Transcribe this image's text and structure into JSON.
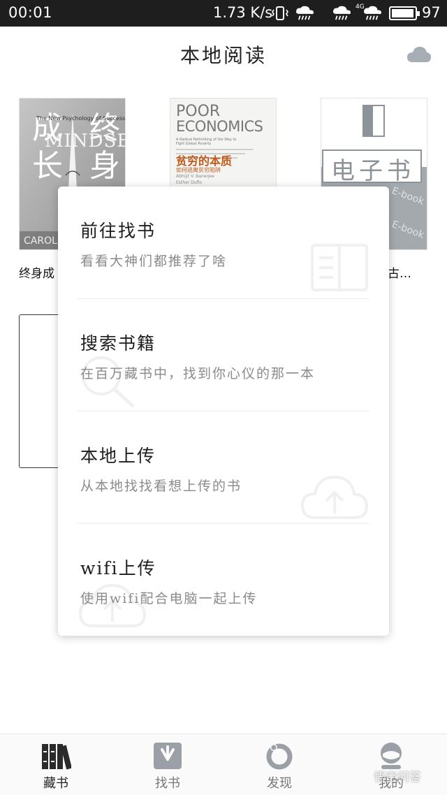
{
  "status_bar": {
    "time": "00:01",
    "net_speed": "1.73 K/s",
    "network_type": "4G",
    "battery_percent": "97",
    "battery_level": 0.97,
    "icons": [
      "vibrate-icon",
      "rain-icon",
      "rain-icon",
      "rain-icon",
      "battery-icon"
    ]
  },
  "header": {
    "title": "本地阅读",
    "cloud_icon": "cloud-icon"
  },
  "books": [
    {
      "title": "终身成",
      "cover_text": [
        "终",
        "身",
        "成",
        "长",
        "MINDSET",
        "The New Psychology of Success",
        "CAROL"
      ]
    },
    {
      "title": "",
      "cover_text": [
        "POOR",
        "ECONOMICS",
        "A Radical Rethinking of the Way to Fight Global Poverty",
        "贫穷的本质",
        "如何逃离贫穷陷阱",
        "Abhijit V. Banerjee",
        "Esther Duflo"
      ]
    },
    {
      "title": "古…",
      "cover_text": [
        "电子书",
        "E-book",
        "E-book"
      ]
    }
  ],
  "popup_menu": {
    "items": [
      {
        "title": "前往找书",
        "subtitle": "看看大神们都推荐了啥",
        "icon": "book-open-icon"
      },
      {
        "title": "搜索书籍",
        "subtitle": "在百万藏书中，找到你心仪的那一本",
        "icon": "search-icon"
      },
      {
        "title": "本地上传",
        "subtitle": "从本地找找看想上传的书",
        "icon": "cloud-upload-icon"
      },
      {
        "title": "wifi上传",
        "subtitle": "使用wifi配合电脑一起上传",
        "icon": "cloud-upload-icon"
      }
    ]
  },
  "bottom_nav": {
    "tabs": [
      {
        "label": "藏书",
        "icon": "bookshelf-icon",
        "active": true
      },
      {
        "label": "找书",
        "icon": "download-box-icon",
        "active": false
      },
      {
        "label": "发现",
        "icon": "discover-ring-icon",
        "active": false
      },
      {
        "label": "我的",
        "icon": "user-icon",
        "active": false
      }
    ]
  },
  "watermark": "悟空问答",
  "colors": {
    "status_bar_bg": "#1e1e1e",
    "active_tab": "#2b2b2b",
    "inactive_tab": "#9aa0a6",
    "subtitle": "#8a8a8a"
  }
}
